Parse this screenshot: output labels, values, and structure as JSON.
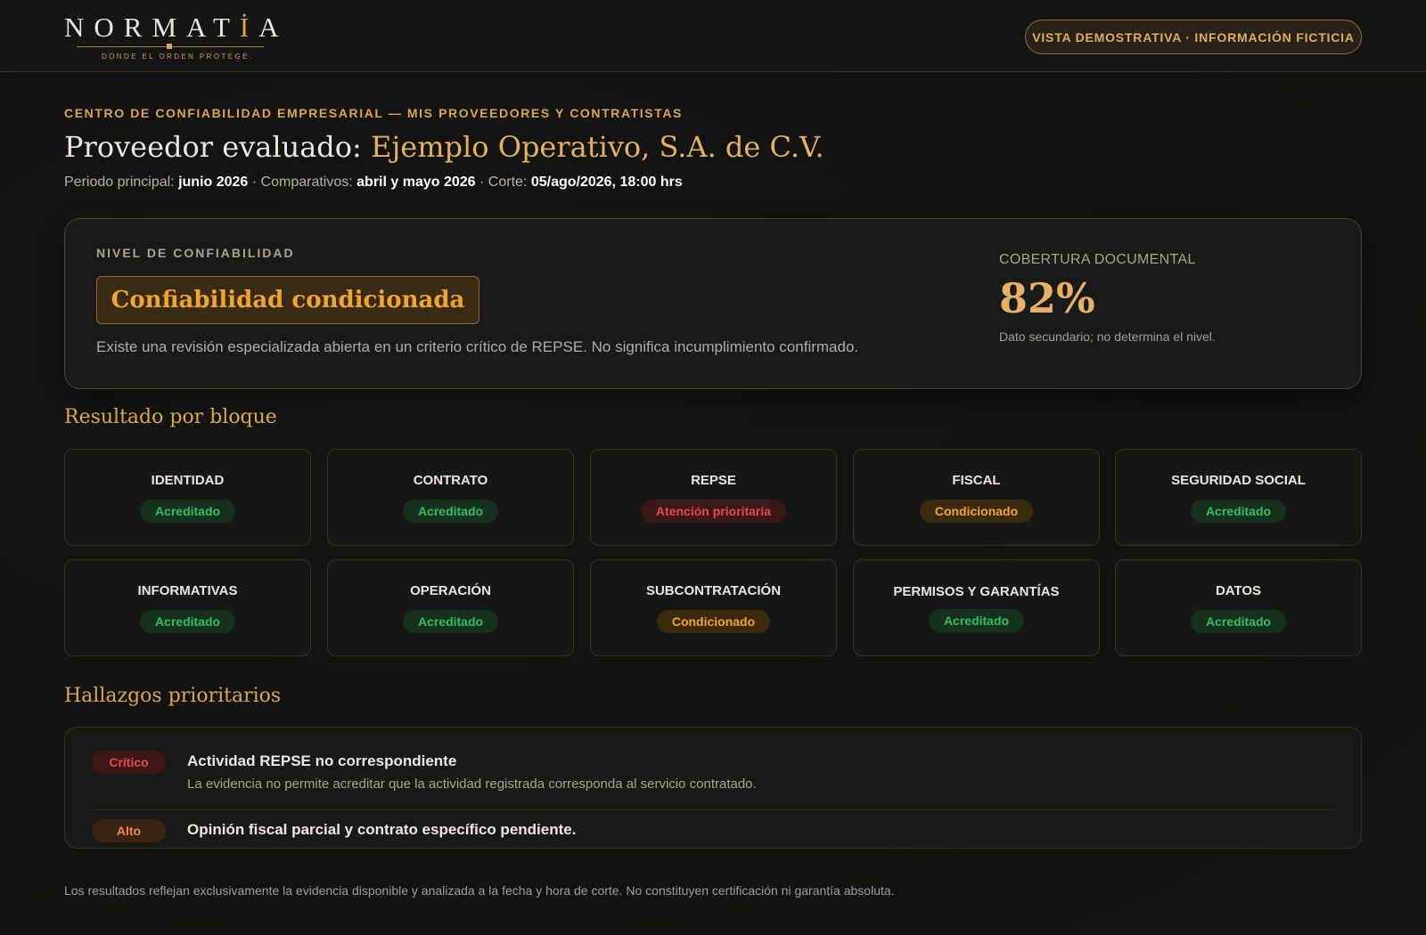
{
  "header": {
    "logo_text": "NORMATIA",
    "logo_tagline": "DONDE EL ORDEN PROTEGE.",
    "demo_badge": "VISTA DEMOSTRATIVA · INFORMACIÓN FICTICIA"
  },
  "intro": {
    "eyebrow": "CENTRO DE CONFIABILIDAD EMPRESARIAL — MIS PROVEEDORES Y CONTRATISTAS",
    "title_prefix": "Proveedor evaluado:",
    "provider_name": "Ejemplo Operativo, S.A. de C.V.",
    "period_label": "Periodo principal:",
    "period_value": "junio 2026",
    "comparatives_label": "· Comparativos:",
    "comparatives_value": "abril y mayo 2026",
    "cutoff_label": "· Corte:",
    "cutoff_value": "05/ago/2026, 18:00 hrs"
  },
  "trust": {
    "label": "NIVEL DE CONFIABILIDAD",
    "level": "Confiabilidad condicionada",
    "description": "Existe una revisión especializada abierta en un criterio crítico de REPSE. No significa incumplimiento confirmado.",
    "coverage_label": "COBERTURA DOCUMENTAL",
    "coverage_value": "82%",
    "coverage_note": "Dato secundario; no determina el nivel."
  },
  "blocks_section": {
    "title": "Resultado por bloque",
    "blocks": [
      {
        "name": "IDENTIDAD",
        "status": "Acreditado",
        "tone": "ok"
      },
      {
        "name": "CONTRATO",
        "status": "Acreditado",
        "tone": "ok"
      },
      {
        "name": "REPSE",
        "status": "Atención prioritaria",
        "tone": "crit"
      },
      {
        "name": "FISCAL",
        "status": "Condicionado",
        "tone": "warn"
      },
      {
        "name": "SEGURIDAD SOCIAL",
        "status": "Acreditado",
        "tone": "ok"
      },
      {
        "name": "INFORMATIVAS",
        "status": "Acreditado",
        "tone": "ok"
      },
      {
        "name": "OPERACIÓN",
        "status": "Acreditado",
        "tone": "ok"
      },
      {
        "name": "SUBCONTRATACIÓN",
        "status": "Condicionado",
        "tone": "warn"
      },
      {
        "name": "PERMISOS Y GARANTÍAS",
        "status": "Acreditado",
        "tone": "ok"
      },
      {
        "name": "DATOS",
        "status": "Acreditado",
        "tone": "ok"
      }
    ]
  },
  "findings_section": {
    "title": "Hallazgos prioritarios",
    "findings": [
      {
        "severity": "Crítico",
        "title": "Actividad REPSE no correspondiente",
        "description": "La evidencia no permite acreditar que la actividad registrada corresponda al servicio contratado."
      },
      {
        "severity": "Alto",
        "title": "Opinión fiscal parcial y contrato específico pendiente."
      }
    ]
  },
  "footer": {
    "disclaimer": "Los resultados reflejan exclusivamente la evidencia disponible y analizada a la fecha y hora de corte. No constituyen certificación ni garantía absoluta."
  }
}
